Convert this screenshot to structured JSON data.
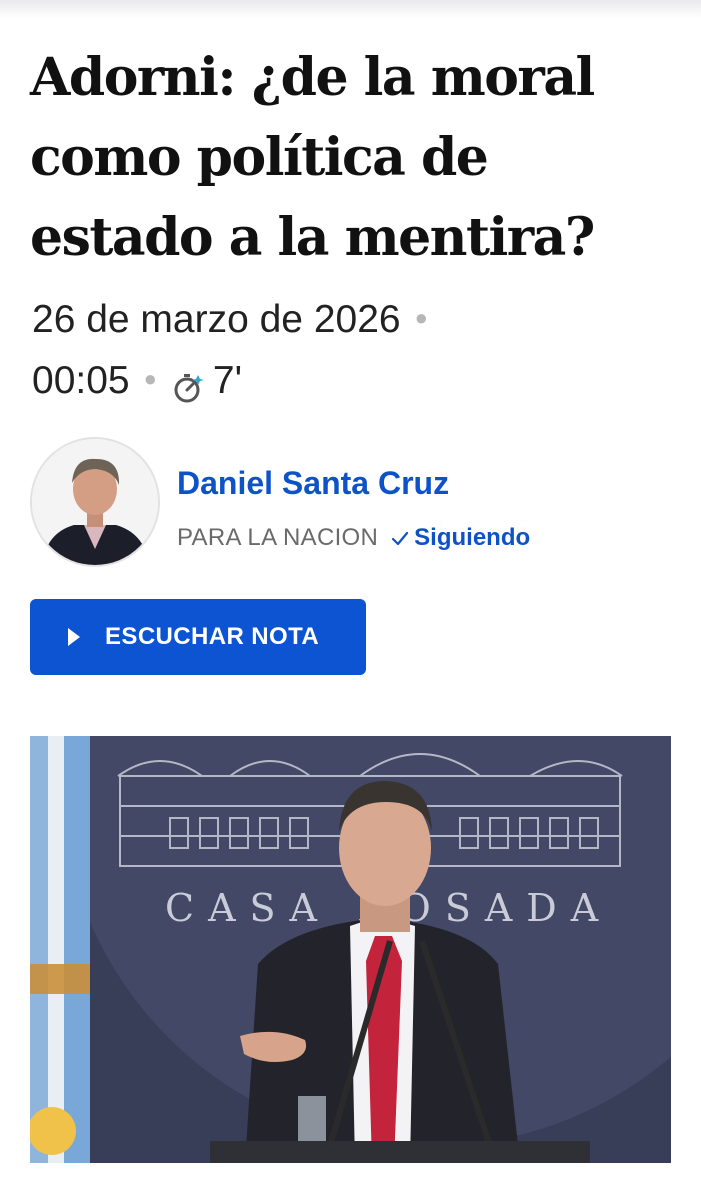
{
  "article": {
    "headline": "Adorni: ¿de la moral como política de estado a la mentira?",
    "date": "26 de marzo de 2026",
    "time": "00:05",
    "reading_time": "7'",
    "reading_time_icon": "stopwatch-icon"
  },
  "author": {
    "name": "Daniel Santa Cruz",
    "outlet": "PARA LA NACION",
    "follow_label": "Siguiendo",
    "follow_icon": "check-icon"
  },
  "listen_button": {
    "label": "ESCUCHAR NOTA",
    "icon": "play-icon"
  },
  "photo": {
    "backdrop_text": "CASA ROSADA"
  },
  "colors": {
    "accent_blue": "#0c54d2",
    "link_blue": "#0e52c8",
    "headline": "#111111"
  }
}
